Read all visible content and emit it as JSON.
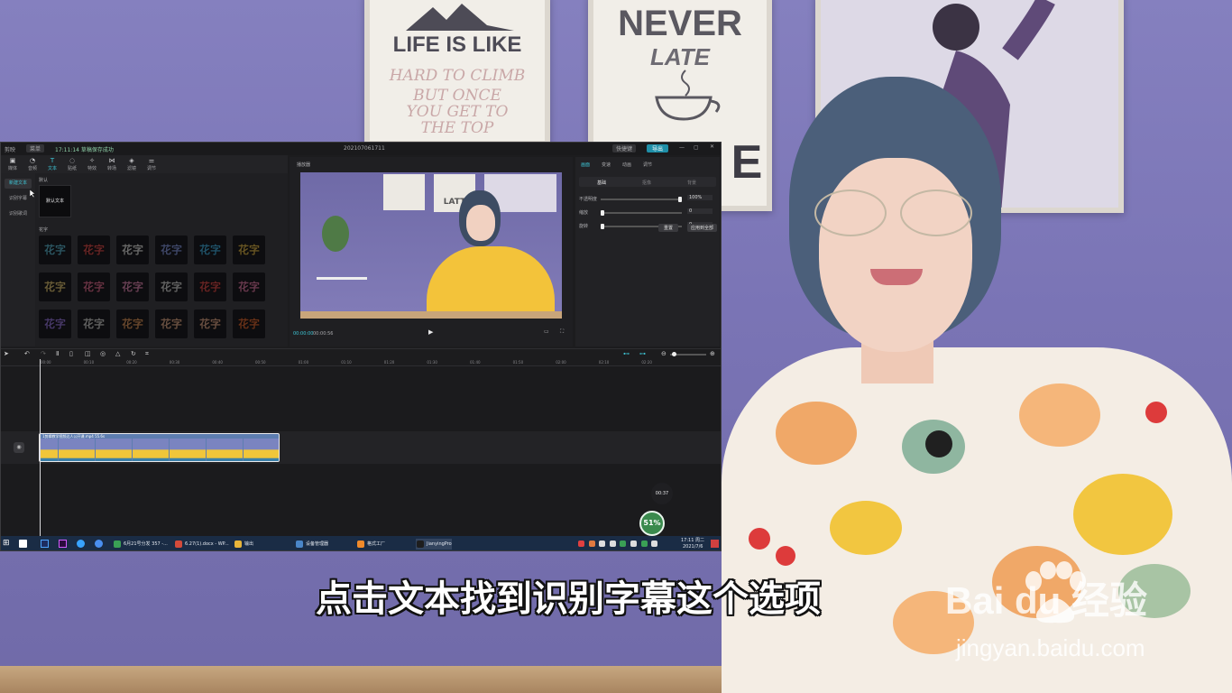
{
  "scene": {
    "posters": [
      {
        "line1": "LIFE IS LIKE",
        "line2": "HARD TO CLIMB",
        "line3": "BUT ONCE",
        "line4": "YOU GET TO",
        "line5": "THE TOP"
      },
      {
        "line1": "NEVER",
        "line2": "LATE",
        "line3": "E"
      }
    ]
  },
  "editor": {
    "window_title": "202107061711",
    "app_name": "剪映",
    "menu_label": "菜单",
    "status_text": "17:11:14 草稿保存成功",
    "shortcut_label": "快捷键",
    "export_label": "导出",
    "toolbar": [
      "媒体",
      "音频",
      "文本",
      "贴纸",
      "特效",
      "转场",
      "滤镜",
      "调节"
    ],
    "left_nav": [
      "新建文本",
      "识别字幕",
      "识别歌词"
    ],
    "panel_default_label": "默认",
    "default_text_tile": "默认文本",
    "fancy_label": "花字",
    "fancy_tile_text": "花字",
    "player_title": "播放器",
    "player_time_current": "00:00:00",
    "player_time_total": "00:00:56",
    "inspector_tabs": [
      "画面",
      "变速",
      "动画",
      "调节"
    ],
    "inspector_subtabs": [
      "基础",
      "抠像",
      "背景"
    ],
    "inspector_props": [
      {
        "label": "不透明度",
        "value": "100%"
      },
      {
        "label": "缩放",
        "value": "0"
      },
      {
        "label": "旋转",
        "value": "0"
      }
    ],
    "inspector_buttons": [
      "重置",
      "应用到全部"
    ],
    "ruler_ticks": [
      "00:00",
      "00:10",
      "00:20",
      "00:30",
      "00:40",
      "00:50",
      "01:00",
      "01:10",
      "01:20",
      "01:30",
      "01:40",
      "01:50",
      "02:00",
      "02:10",
      "02:20"
    ],
    "clip_label": "1剪辑教学视频达人公开课.mp4  55.6s",
    "taskbar": [
      "6月21号分发 357 -...",
      "6.27(1).docx - WP...",
      "输出",
      "设备管理器",
      "格式工厂",
      "JianyingPro"
    ],
    "clock_time": "17:11 周二",
    "clock_date": "2021/7/6"
  },
  "overlay": {
    "timer": "00:37",
    "progress_percent": "51%"
  },
  "subtitle": "点击文本找到识别字幕这个选项",
  "watermark": {
    "logo": "Bai  du 经验",
    "url": "jingyan.baidu.com"
  },
  "colors": {
    "accent": "#3ec6d6",
    "wall": "#7c74b4",
    "editor_bg": "#1c1c1e"
  }
}
